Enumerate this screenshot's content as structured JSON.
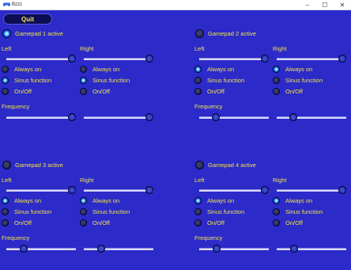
{
  "window": {
    "title": "Bzzz",
    "minimize": "–",
    "maximize": "☐",
    "close": "✕"
  },
  "quit_label": "Quit",
  "labels": {
    "left": "Left",
    "right": "Right",
    "frequency": "Frequency",
    "always_on": "Always on",
    "sinus": "Sinus function",
    "onoff": "On/Off"
  },
  "gamepads": [
    {
      "title": "Gamepad 1 active",
      "active": true,
      "left_mode": "sinus",
      "right_mode": "sinus",
      "left_level": 1.0,
      "right_level": 1.0,
      "left_freq": 1.0,
      "right_freq": 1.0
    },
    {
      "title": "Gamepad 2 active",
      "active": false,
      "left_mode": "always_on",
      "right_mode": "always_on",
      "left_level": 1.0,
      "right_level": 1.0,
      "left_freq": 0.2,
      "right_freq": 0.2
    },
    {
      "title": "Gamepad 3 active",
      "active": false,
      "left_mode": "always_on",
      "right_mode": "always_on",
      "left_level": 1.0,
      "right_level": 1.0,
      "left_freq": 0.22,
      "right_freq": 0.22
    },
    {
      "title": "Gamepad 4 active",
      "active": false,
      "left_mode": "always_on",
      "right_mode": "always_on",
      "left_level": 1.0,
      "right_level": 1.0,
      "left_freq": 0.22,
      "right_freq": 0.22
    }
  ],
  "colors": {
    "background": "#2c2ac8",
    "label": "#f1e34a",
    "quit_bg": "#0d0d55"
  }
}
